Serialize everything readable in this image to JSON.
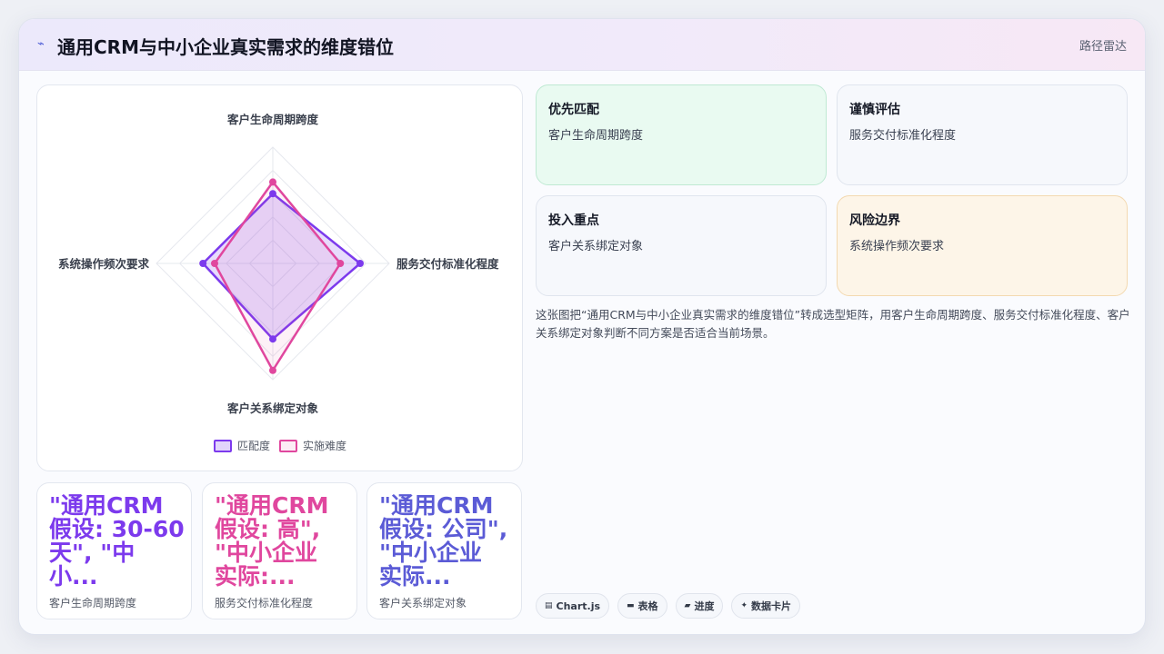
{
  "header": {
    "icon": "trend-icon",
    "title": "通用CRM与中小企业真实需求的维度错位",
    "right_label": "路径雷达"
  },
  "chart_data": {
    "type": "radar",
    "axes": [
      "客户生命周期跨度",
      "服务交付标准化程度",
      "客户关系绑定对象",
      "系统操作频次要求"
    ],
    "series": [
      {
        "name": "匹配度",
        "values": [
          0.6,
          0.75,
          0.65,
          0.6
        ],
        "color": "#7c3aed"
      },
      {
        "name": "实施难度",
        "values": [
          0.7,
          0.58,
          0.92,
          0.5
        ],
        "color": "#e0479e"
      }
    ],
    "range": [
      0,
      1
    ],
    "legend_position": "bottom"
  },
  "stats": [
    {
      "big": "\"通用CRM\n假设: 30-60\n天\", \"中\n小...",
      "caption": "客户生命周期跨度",
      "color": "#7c3aed"
    },
    {
      "big": "\"通用CRM\n假设: 高\",\n\"中小企业\n实际:...",
      "caption": "服务交付标准化程度",
      "color": "#e0479e"
    },
    {
      "big": "\"通用CRM\n假设: 公司\",\n\"中小企业\n实际...",
      "caption": "客户关系绑定对象",
      "color": "#5b5bd6"
    }
  ],
  "quadrants": [
    {
      "title": "优先匹配",
      "value": "客户生命周期跨度",
      "bg": "#e9faf1",
      "border": "#bfe9d3"
    },
    {
      "title": "谨慎评估",
      "value": "服务交付标准化程度",
      "bg": "#f6f8fc",
      "border": "#e0e5ee"
    },
    {
      "title": "投入重点",
      "value": "客户关系绑定对象",
      "bg": "#f6f8fc",
      "border": "#e0e5ee"
    },
    {
      "title": "风险边界",
      "value": "系统操作频次要求",
      "bg": "#fdf5e8",
      "border": "#f3d9b0"
    }
  ],
  "description": "这张图把“通用CRM与中小企业真实需求的维度错位”转成选型矩阵，用客户生命周期跨度、服务交付标准化程度、客户关系绑定对象判断不同方案是否适合当前场景。",
  "chips": [
    {
      "icon": "chart-icon",
      "glyph": "▤",
      "label": "Chart.js"
    },
    {
      "icon": "table-icon",
      "glyph": "▬",
      "label": "表格"
    },
    {
      "icon": "progress-icon",
      "glyph": "▰",
      "label": "进度"
    },
    {
      "icon": "sparkle-icon",
      "glyph": "✦",
      "label": "数据卡片"
    }
  ]
}
